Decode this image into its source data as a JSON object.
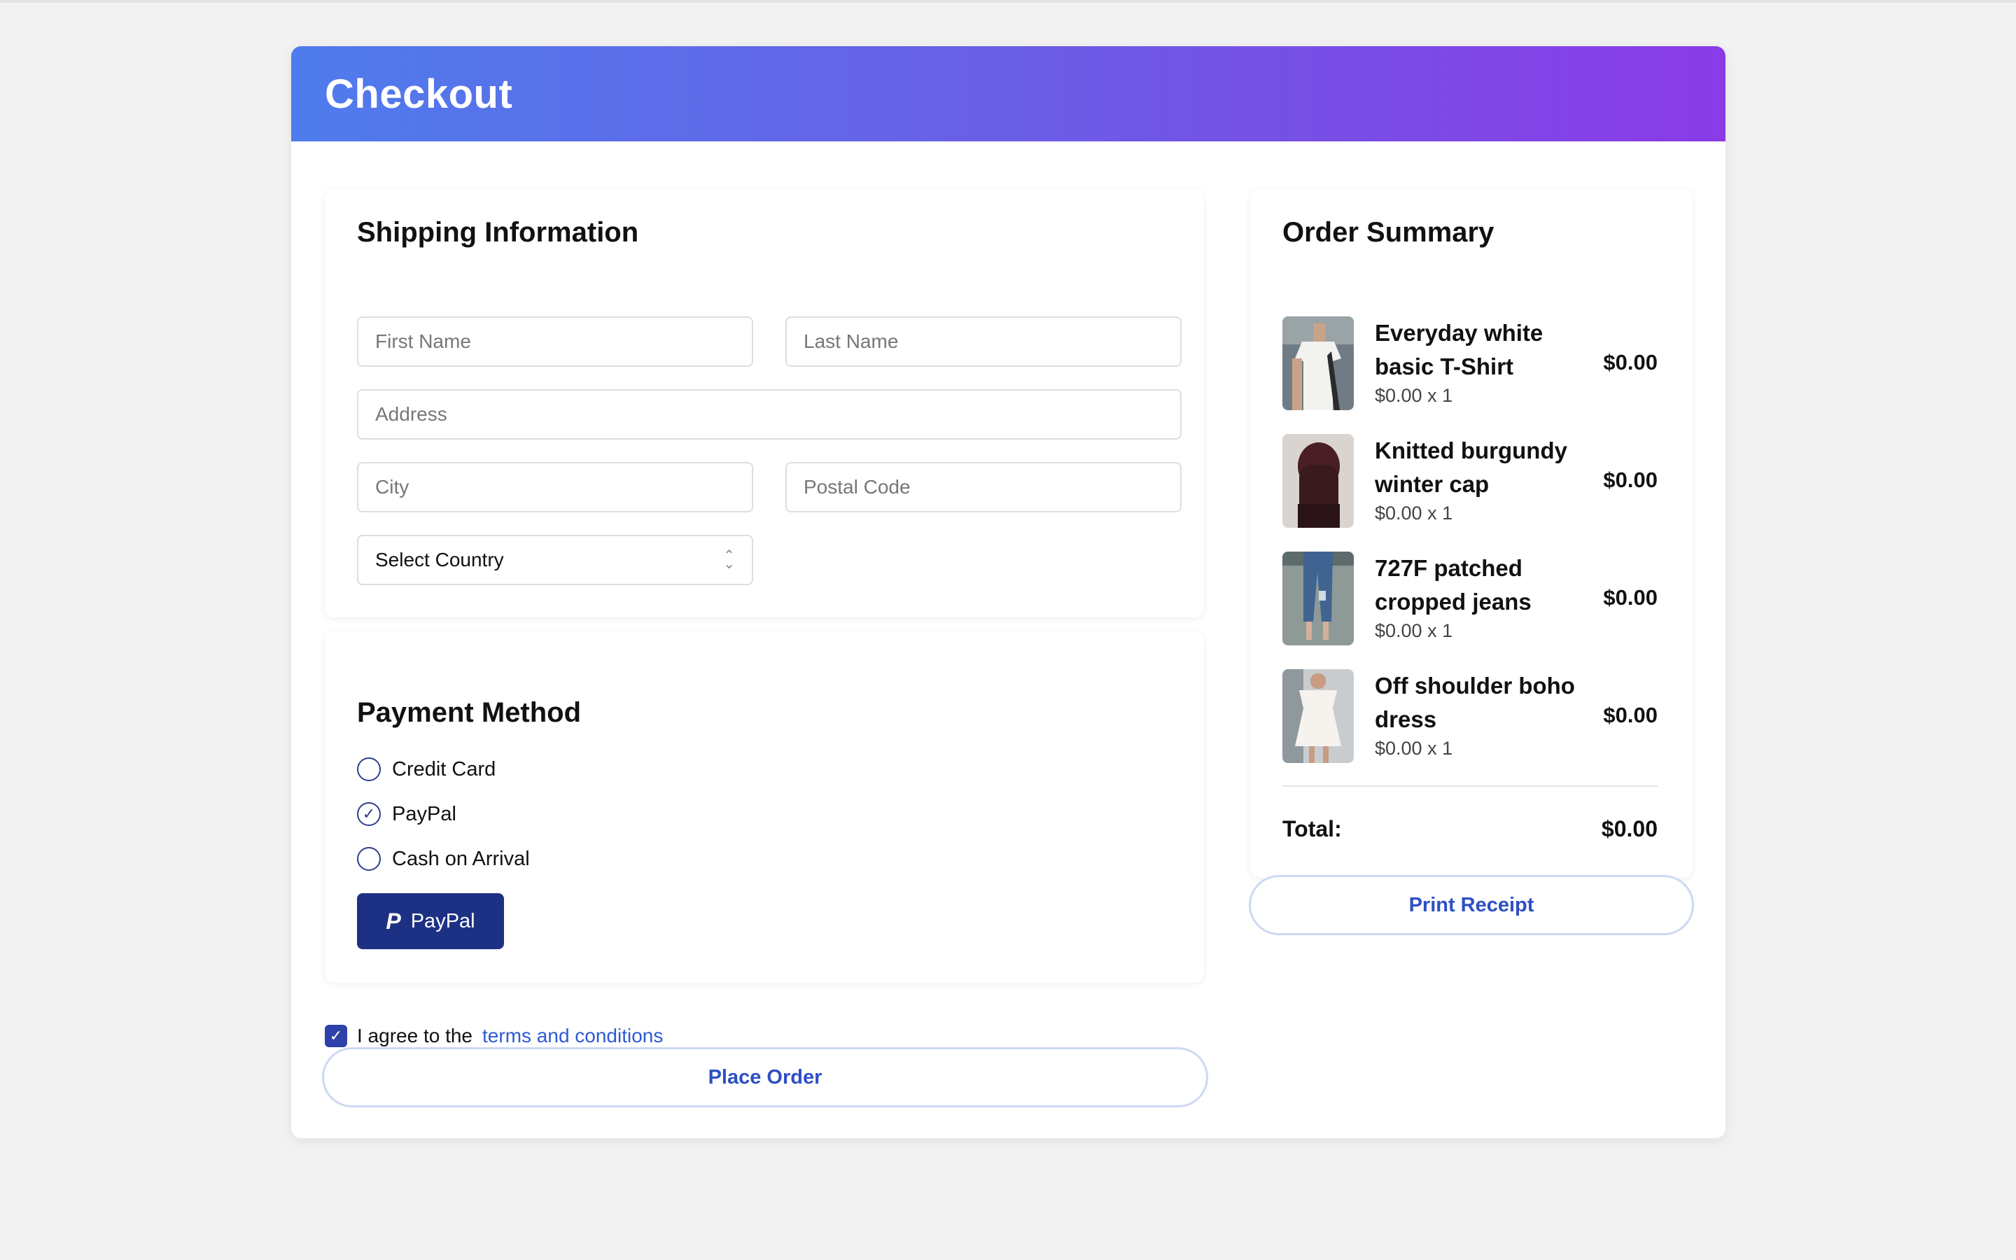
{
  "header": {
    "title": "Checkout"
  },
  "shipping": {
    "title": "Shipping Information",
    "first_name_placeholder": "First Name",
    "last_name_placeholder": "Last Name",
    "address_placeholder": "Address",
    "city_placeholder": "City",
    "postal_placeholder": "Postal Code",
    "country_selected": "Select Country"
  },
  "payment": {
    "title": "Payment Method",
    "options": [
      {
        "label": "Credit Card",
        "selected": false
      },
      {
        "label": "PayPal",
        "selected": true
      },
      {
        "label": "Cash on Arrival",
        "selected": false
      }
    ],
    "paypal_button_label": "PayPal"
  },
  "agreement": {
    "prefix": "I agree to the",
    "link_text": "terms and conditions",
    "checked": true
  },
  "place_order_label": "Place Order",
  "summary": {
    "title": "Order Summary",
    "items": [
      {
        "name": "Everyday white basic T-Shirt",
        "qty_line": "$0.00 x 1",
        "price": "$0.00"
      },
      {
        "name": "Knitted burgundy winter cap",
        "qty_line": "$0.00 x 1",
        "price": "$0.00"
      },
      {
        "name": "727F patched cropped jeans",
        "qty_line": "$0.00 x 1",
        "price": "$0.00"
      },
      {
        "name": "Off shoulder boho dress",
        "qty_line": "$0.00 x 1",
        "price": "$0.00"
      }
    ],
    "total_label": "Total:",
    "total_value": "$0.00"
  },
  "print_receipt_label": "Print Receipt",
  "colors": {
    "header_gradient_start": "#4f7cec",
    "header_gradient_end": "#8a3be6",
    "paypal_button": "#1d3184",
    "link": "#2e5ad6",
    "outline_button_text": "#2e4fc4"
  }
}
